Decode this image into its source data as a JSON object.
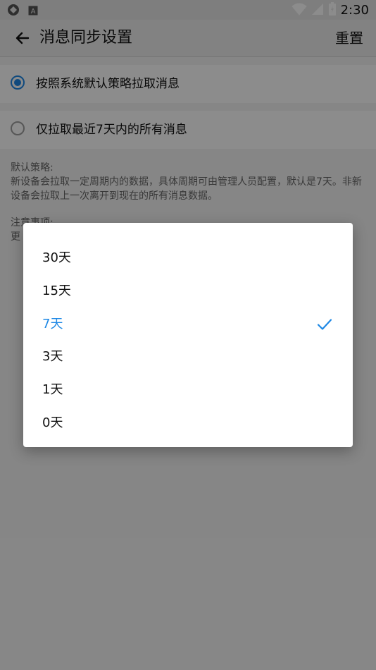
{
  "status_bar": {
    "time": "2:30",
    "icons": [
      "app-icon",
      "notification-icon",
      "wifi-icon",
      "signal-icon",
      "battery-icon"
    ]
  },
  "toolbar": {
    "title": "消息同步设置",
    "reset_label": "重置",
    "back_icon": "back-arrow-icon"
  },
  "options": [
    {
      "label": "按照系统默认策略拉取消息",
      "checked": true
    },
    {
      "label": "仅拉取最近7天内的所有消息",
      "checked": false
    }
  ],
  "description": {
    "title": "默认策略:",
    "text": "新设备会拉取一定周期内的数据，具体周期可由管理人员配置，默认是7天。非新设备会拉取上一次离开到现在的所有消息数据。",
    "note_title": "注意事项:",
    "note_text": "更"
  },
  "dialog": {
    "items": [
      {
        "label": "30天",
        "selected": false
      },
      {
        "label": "15天",
        "selected": false
      },
      {
        "label": "7天",
        "selected": true
      },
      {
        "label": "3天",
        "selected": false
      },
      {
        "label": "1天",
        "selected": false
      },
      {
        "label": "0天",
        "selected": false
      }
    ],
    "accent_color": "#1e88e5"
  }
}
